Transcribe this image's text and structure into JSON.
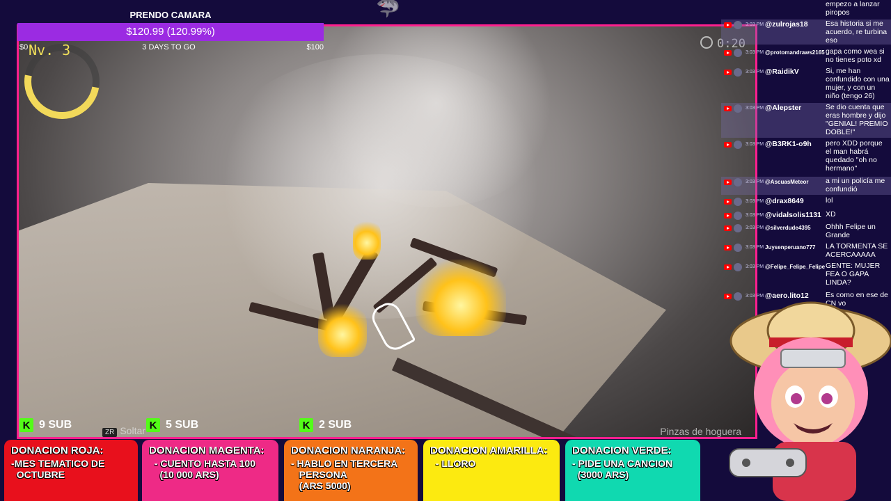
{
  "goal": {
    "title": "PRENDO CAMARA",
    "amount": "$120.99 (120.99%)",
    "start": "$0",
    "days_left": "3 DAYS TO GO",
    "end": "$100",
    "progress_fraction": 1.0
  },
  "game": {
    "level_label": "Nv. 3",
    "timer": "0:20",
    "hint_left": "Soltar",
    "hint_left_key": "ZR",
    "hint_right": "Pinzas de hoguera"
  },
  "sub_goals": [
    {
      "k": "K",
      "label": "9 SUB"
    },
    {
      "k": "K",
      "label": "5 SUB"
    },
    {
      "k": "K",
      "label": "2 SUB"
    }
  ],
  "donations": [
    {
      "title": "DONACION ROJA:",
      "lines": [
        "-MES TEMATICO DE",
        "  OCTUBRE"
      ],
      "color": "#e8101c"
    },
    {
      "title": "DONACION MAGENTA:",
      "lines": [
        "  - CUENTO HASTA 100",
        "    (10 000 ARS)"
      ],
      "color": "#ee2a86"
    },
    {
      "title": "DONACION NARANJA:",
      "lines": [
        "- HABLO EN TERCERA",
        "   PERSONA",
        "   (ARS 5000)"
      ],
      "color": "#f37318"
    },
    {
      "title": "DONACION AMARILLA:",
      "lines": [
        "  - LLORO"
      ],
      "color": "#fcea10"
    },
    {
      "title": "DONACION VERDE:",
      "lines": [
        "- PIDE UNA CANCION",
        "  (3000 ARS)"
      ],
      "color": "#10d9b0"
    }
  ],
  "chat": {
    "overflow_top": "empezo a lanzar\npiropos",
    "messages": [
      {
        "time": "3:03 PM",
        "user": "@zulrojas18",
        "text": "Esa historia si me acuerdo, re turbina eso",
        "highlight": true
      },
      {
        "time": "3:03 PM",
        "user": "@protomandraws2165",
        "text": "gapa como wea si no tienes poto xd",
        "highlight": false,
        "small": true
      },
      {
        "time": "3:03 PM",
        "user": "@RaidikV",
        "text": "Si, me han confundido con una mujer, y con un niño (tengo 26)",
        "highlight": false
      },
      {
        "time": "3:03 PM",
        "user": "@Alepster",
        "text": "Se dio cuenta que eras hombre y dijo \"GENIAL! PREMIO DOBLE!\"",
        "highlight": true
      },
      {
        "time": "3:03 PM",
        "user": "@B3RK1-o9h",
        "text": "pero XDD porque el man habrá quedado \"oh no hermano\"",
        "highlight": false
      },
      {
        "time": "3:03 PM",
        "user": "@AscuasMeteor",
        "text": "a mi un policía me confundió",
        "highlight": true,
        "small": true
      },
      {
        "time": "3:03 PM",
        "user": "@drax8649",
        "text": "lol",
        "highlight": false
      },
      {
        "time": "3:03 PM",
        "user": "@vidalsolis1131",
        "text": "XD",
        "highlight": false
      },
      {
        "time": "3:03 PM",
        "user": "@silverdude4395",
        "text": "Ohhh Felipe un Grande",
        "highlight": false,
        "small": true
      },
      {
        "time": "3:03 PM",
        "user": "Juysenperuano777",
        "text": "LA TORMENTA SE ACERCAAAAA",
        "highlight": false,
        "small": true
      },
      {
        "time": "3:03 PM",
        "user": "@Felipe_Felipe_Felipe",
        "text": "GENTE: MUJER FEA O GAPA LINDA?",
        "highlight": false,
        "small": true
      },
      {
        "time": "3:03 PM",
        "user": "@aero.lito12",
        "text": "Es como en ese de CN vo",
        "highlight": false
      }
    ]
  }
}
